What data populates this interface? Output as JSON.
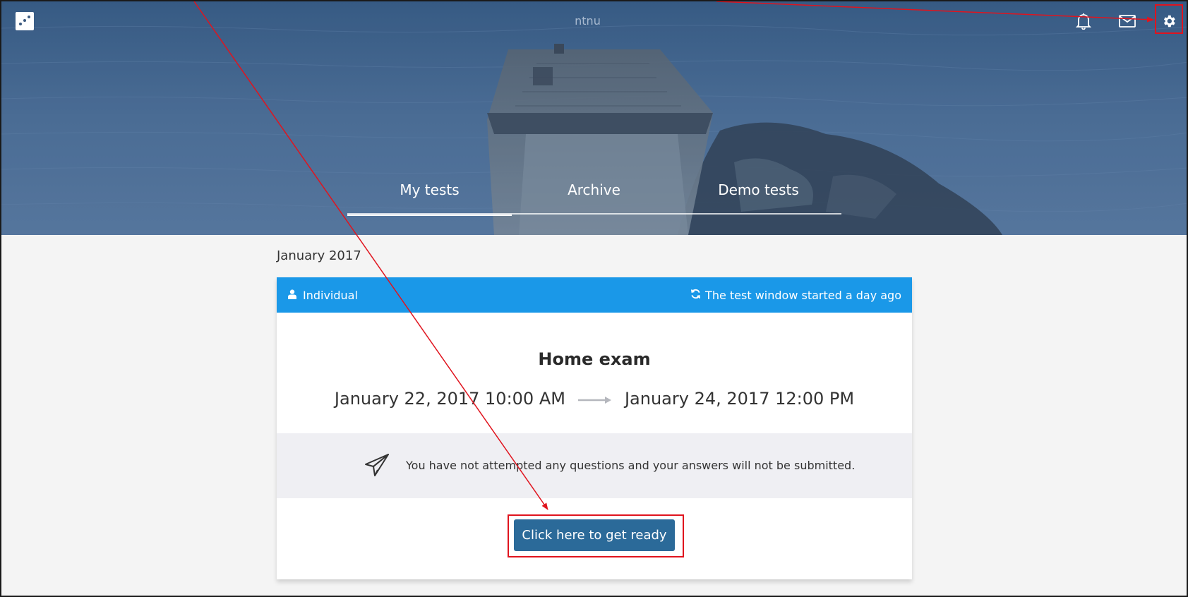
{
  "header": {
    "tenant": "ntnu",
    "logo_icon": "app-logo-icon",
    "icons": [
      "bell-icon",
      "envelope-icon",
      "gear-icon"
    ]
  },
  "tabs": [
    {
      "label": "My tests",
      "active": true
    },
    {
      "label": "Archive",
      "active": false
    },
    {
      "label": "Demo tests",
      "active": false
    }
  ],
  "content": {
    "month": "January 2017",
    "card": {
      "type_label": "Individual",
      "type_icon": "user-icon",
      "status": "The test window started a day ago",
      "status_icon": "refresh-icon",
      "title": "Home exam",
      "start": "January 22, 2017 10:00 AM",
      "end": "January 24, 2017 12:00 PM",
      "arrow_icon": "arrow-right-icon",
      "notice": "You have not attempted any questions and your answers will not be submitted.",
      "notice_icon": "paper-plane-icon",
      "button_label": "Click here to get ready"
    }
  },
  "colors": {
    "header_bar": "#1a98e8",
    "button": "#2b6a99",
    "notice_bg": "#efeff3",
    "annotation": "#e0141e"
  }
}
